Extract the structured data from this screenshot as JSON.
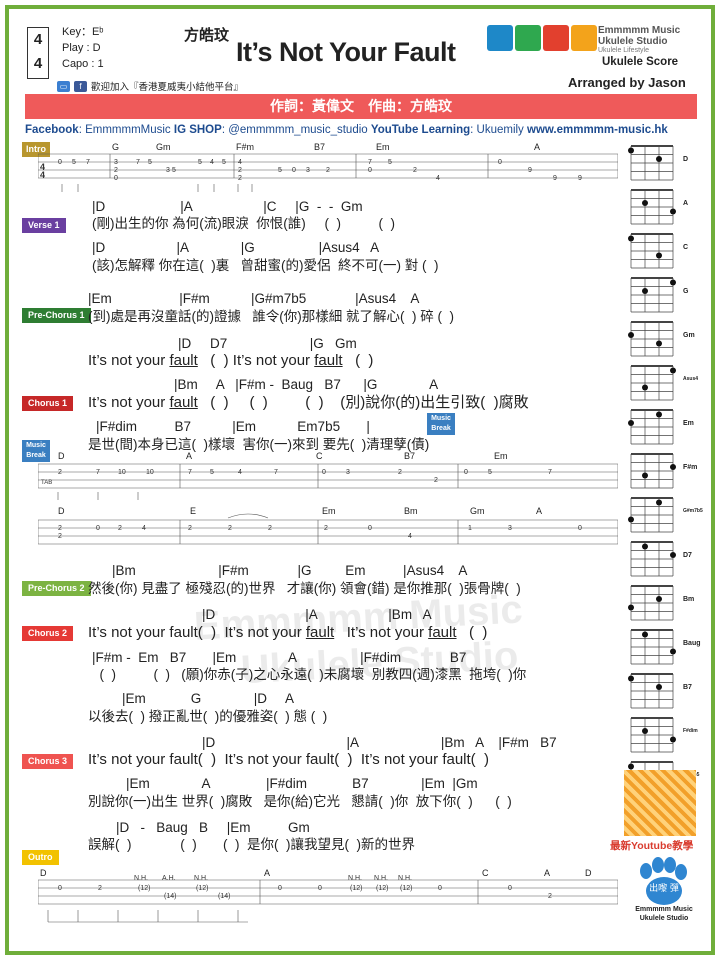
{
  "header": {
    "time_sig_top": "4",
    "time_sig_bottom": "4",
    "key": "Key：Eᵇ",
    "play": "Play : D",
    "capo": "Capo : 1",
    "composer": "方皓玟",
    "title": "It’s Not Your Fault",
    "group_note": "歡迎加入『香港夏威夷小結他平台』",
    "brand_line1": "Emmmmm Music",
    "brand_line2": "Ukulele Studio",
    "brand_line3": "Ukulele Lifestyle",
    "score_label": "Ukulele Score",
    "arranged_by": "Arranged by Jason",
    "banner": "作詞：黃偉文　作曲：方皓玟",
    "social": {
      "fb_label": "Facebook",
      "fb_value": ": EmmmmmMusic ",
      "ig_label": "IG SHOP",
      "ig_value": ": @emmmmm_music_studio ",
      "yt_label": "YouTube Learning",
      "yt_value": ": Ukuemily ",
      "web": "www.emmmmm-music.hk"
    }
  },
  "sections": {
    "intro": "Intro",
    "verse1": "Verse 1",
    "prechorus1": "Pre-Chorus 1",
    "chorus1": "Chorus 1",
    "musicbreak": "Music Break",
    "prechorus2": "Pre-Chorus 2",
    "chorus2": "Chorus 2",
    "chorus3": "Chorus 3",
    "outro": "Outro"
  },
  "colors": {
    "intro": "#b8962e",
    "verse1": "#6a3fa0",
    "prechorus1": "#2e7d32",
    "chorus1": "#c62828",
    "musicbreak": "#3a7fc1",
    "prechorus2": "#7cb342",
    "chorus2": "#e53935",
    "chorus3": "#ef5350",
    "outro": "#f2c200",
    "frame": "#6fae3a",
    "banner": "#ef5a5a"
  },
  "intro_tab": {
    "chords": [
      "G",
      "Gm",
      "F#m",
      "B7",
      "Em",
      "A"
    ]
  },
  "lyrics": {
    "v1_c1": "|D                    |A                   |C     |G  -  -  Gm",
    "v1_l1": "(剛)出生的你 為何(流)眼淚  你恨(誰)     (  )          (  )",
    "v1_c2": "|D                   |A              |G                 |Asus4   A",
    "v1_l2": "(該)怎解釋 你在這(  )裏   曾甜蜜(的)愛侶  終不可(一) 對 (  )",
    "pc1_c1": "|Em                  |F#m           |G#m7b5             |Asus4    A",
    "pc1_l1": "(到)處是再沒童話(的)證據   誰令(你)那樣細 就了解心(  ) 碎 (  )",
    "pc1_c2": "|D     D7                      |G   Gm",
    "pc1_l2a": "It’s not your ",
    "pc1_l2b": "fault",
    "pc1_l2c": "   (  ) It’s not your ",
    "pc1_l2d": "fault",
    "pc1_l2e": "   (  )",
    "ch1_c1": "|Bm     A   |F#m -  Baug   B7      |G              A",
    "ch1_l1a": "It’s not your ",
    "ch1_l1b": "fault",
    "ch1_l1c": "   (  )     (  )         (  )    (別)說你(的)出生引致(  )腐敗",
    "ch1_c2": "|F#dim          B7           |Em           Em7b5       |",
    "ch1_l2": "是世(間)本身已這(  )樣壞  害你(一)來到 要先(  )清理孽(債)",
    "pc2_c1": "|Bm                      |F#m             |G         Em          |Asus4    A",
    "pc2_l1": "然後(你) 見盡了 極殘忍(的)世界   才讓(你) 領會(錯) 是你推那(  )張骨牌(  )",
    "ch2_c1": "|D                        |A                   |Bm   A",
    "ch2_l1a": "It’s not your fault(  )  It’s not your ",
    "ch2_l1b": "fault",
    "ch2_l1c": "   It’s not your ",
    "ch2_l1d": "fault",
    "ch2_l1e": "   (  )",
    "ch2_c2": "|F#m -  Em   B7       |Em              A                 |F#dim             B7",
    "ch2_l2": "  (  )          (  )   (願)你赤(子)之心永遠(  )未腐壞  別教四(週)漆黑  拖垮(  )你",
    "ch2_c3": "|Em            G              |D     A",
    "ch2_l3": "以後去(  ) 撥正亂世(  )的優雅姿(  ) 態 (  )",
    "ch3_c1": "|D                                   |A                      |Bm   A    |F#m   B7",
    "ch3_l1": "It’s not your fault(  )  It’s not your fault(  )  It’s not your fault(  )",
    "ch3_c2": "|Em              A               |F#dim            B7              |Em  |Gm",
    "ch3_l2": "別說你(一)出生 世界(  )腐敗   是你(給)它光   懇請(  )你  放下你(  )      (  )",
    "ch3_c3": "|D   -   Baug   B     |Em          Gm",
    "ch3_l3": "誤解(  )             (  )       (  )  是你(  )讓我望見(  )新的世界"
  },
  "music_break_note": "Music Break",
  "break_tab": {
    "row1_chords": [
      "D",
      "A",
      "C",
      "B7",
      "Em"
    ],
    "row2_chords": [
      "D",
      "E",
      "Em",
      "Bm",
      "Gm",
      "A"
    ]
  },
  "outro_tab": {
    "chords": [
      "D",
      "A",
      "C",
      "A",
      "D"
    ]
  },
  "chord_diagrams": [
    "D",
    "A",
    "C",
    "G",
    "Gm",
    "Asus4",
    "Em",
    "F#m",
    "G#m7b5",
    "D7",
    "Bm",
    "Baug",
    "B7",
    "F#dim",
    "Em7b5"
  ],
  "qr_label": "最新Youtube教學",
  "paw_text": "出嚟 彈",
  "paw_brand": "Emmmmm Music Ukulele Studio",
  "watermark": "Emmmmm Music\n    Ukulele Studio"
}
